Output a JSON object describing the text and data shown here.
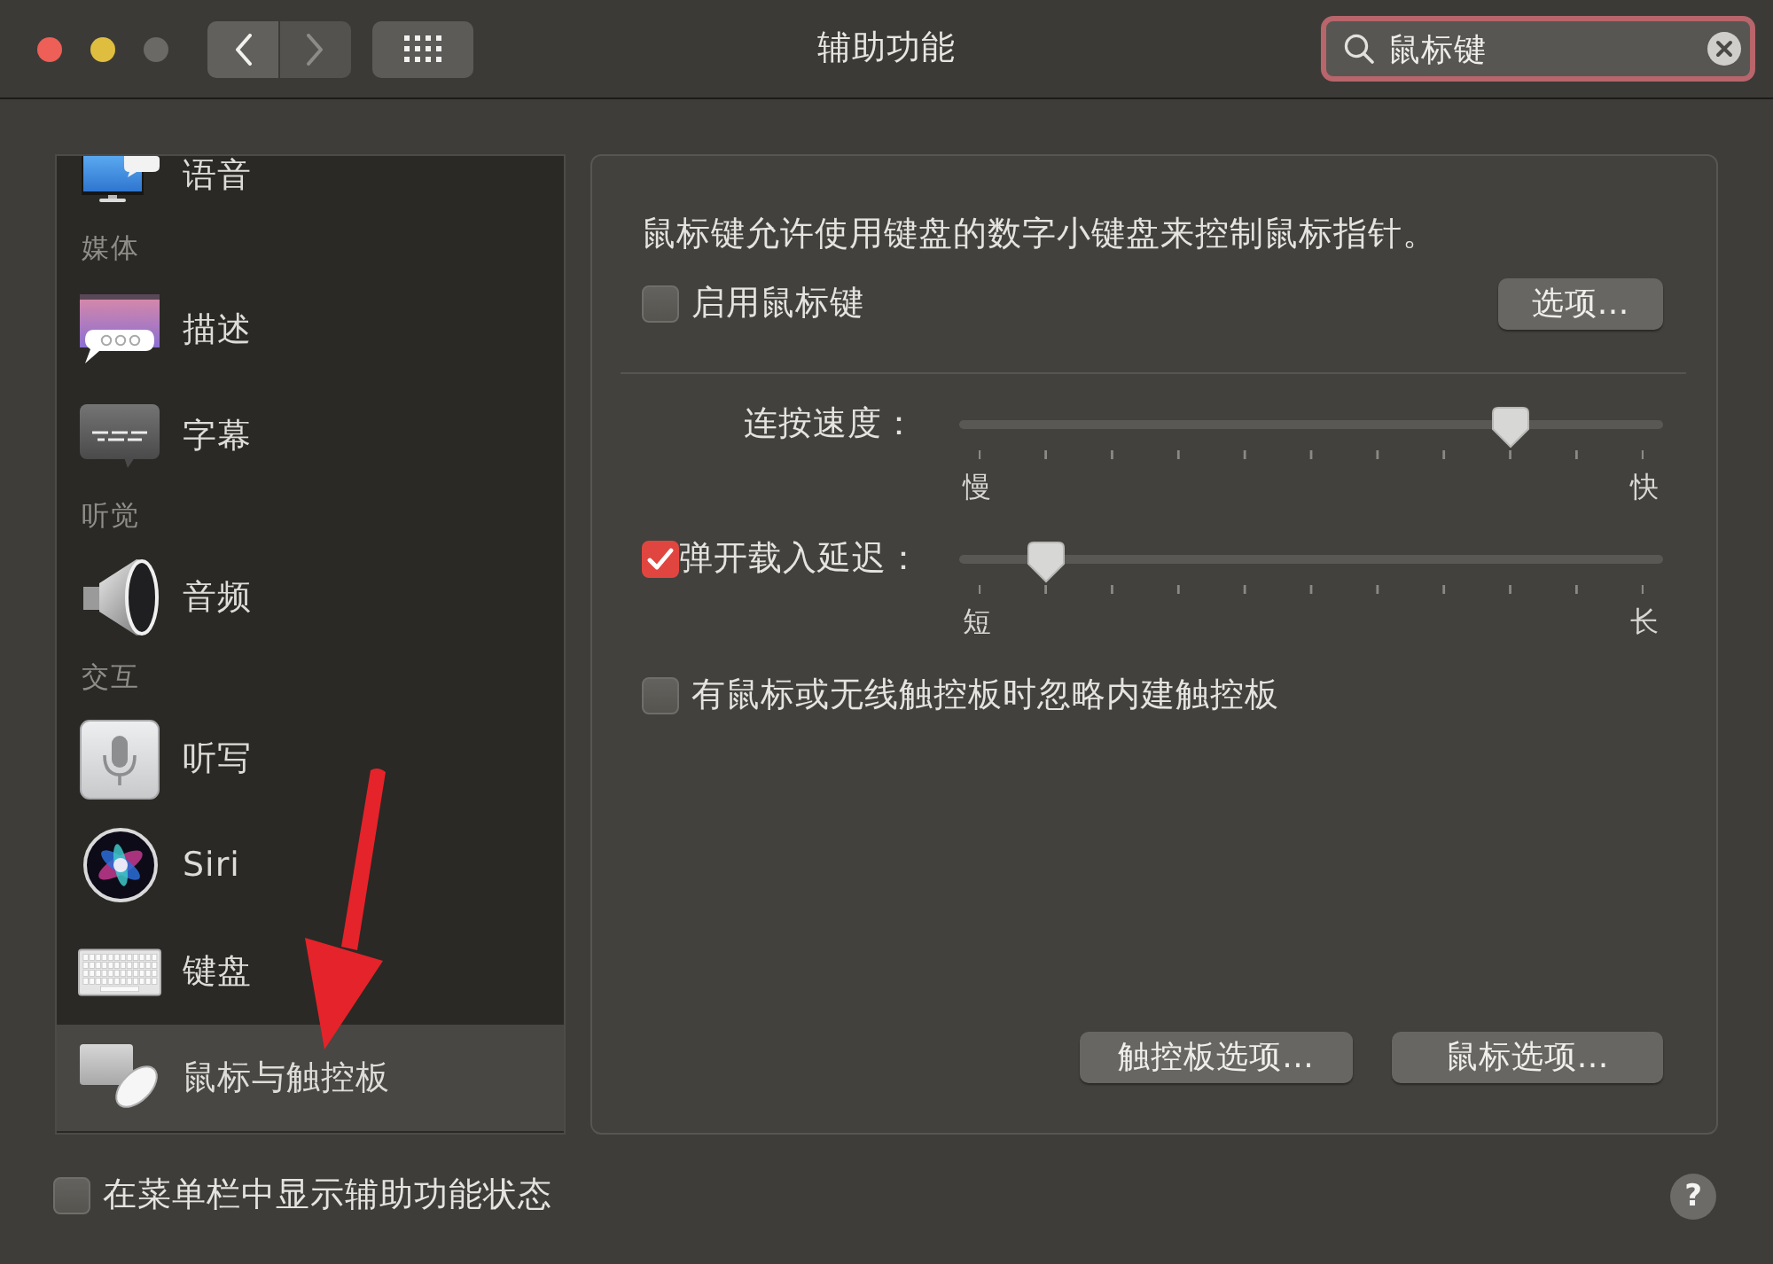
{
  "window": {
    "title": "辅助功能"
  },
  "window_buttons": [
    {
      "kind": "close",
      "disabled": false
    },
    {
      "kind": "minimize",
      "disabled": false
    },
    {
      "kind": "zoom",
      "disabled": true
    }
  ],
  "nav_buttons": [
    {
      "kind": "back",
      "disabled": false
    },
    {
      "kind": "forward",
      "disabled": true
    }
  ],
  "search": {
    "value": "鼠标键",
    "focused": true
  },
  "sidebar": {
    "items": [
      {
        "kind": "item",
        "label": "语音",
        "selected": false
      },
      {
        "kind": "section",
        "label": "媒体"
      },
      {
        "kind": "item",
        "label": "描述",
        "selected": false
      },
      {
        "kind": "item",
        "label": "字幕",
        "selected": false
      },
      {
        "kind": "section",
        "label": "听觉"
      },
      {
        "kind": "item",
        "label": "音频",
        "selected": false
      },
      {
        "kind": "section",
        "label": "交互"
      },
      {
        "kind": "item",
        "label": "听写",
        "selected": false
      },
      {
        "kind": "item",
        "label": "Siri",
        "selected": false
      },
      {
        "kind": "item",
        "label": "键盘",
        "selected": false
      },
      {
        "kind": "item",
        "label": "鼠标与触控板",
        "selected": true
      }
    ]
  },
  "pane": {
    "description": "鼠标键允许使用键盘的数字小键盘来控制鼠标指针。",
    "rows": [
      {
        "kind": "checkbox",
        "label": "启用鼠标键",
        "checked": false,
        "button": "选项…"
      },
      {
        "kind": "divider"
      },
      {
        "kind": "slider",
        "label": "连按速度：",
        "level": 0.8,
        "min_label": "慢",
        "max_label": "快"
      },
      {
        "kind": "checkbox-slider",
        "label": "弹开载入延迟：",
        "checked": true,
        "level": 0.1,
        "min_label": "短",
        "max_label": "长"
      },
      {
        "kind": "checkbox",
        "label": "有鼠标或无线触控板时忽略内建触控板",
        "checked": false
      }
    ],
    "buttons": [
      "触控板选项…",
      "鼠标选项…"
    ]
  },
  "footer": {
    "checkbox": {
      "label": "在菜单栏中显示辅助功能状态",
      "checked": false
    },
    "help": "?"
  },
  "annotations": [
    {
      "kind": "arrow"
    }
  ]
}
